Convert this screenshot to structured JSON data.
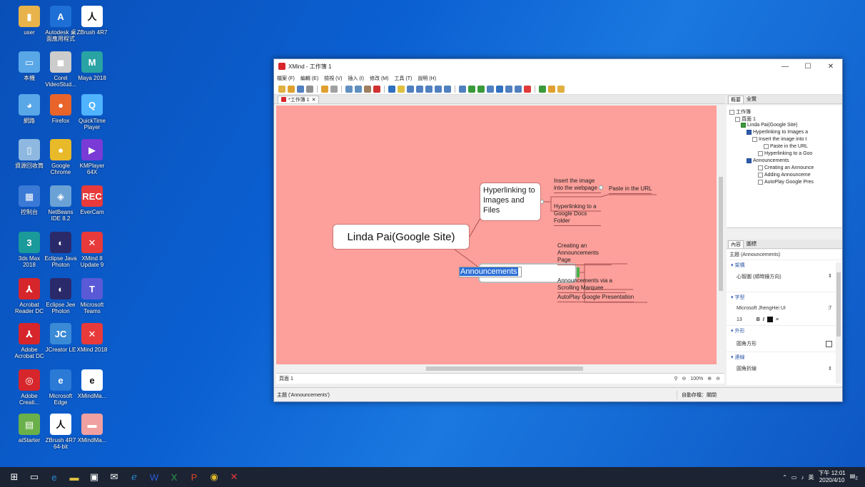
{
  "desktop": {
    "icons": [
      {
        "label": "user",
        "color": "#e8b34a",
        "glyph": "▮"
      },
      {
        "label": "Autodesk 桌面應用程式",
        "color": "#1e6fd6",
        "glyph": "A"
      },
      {
        "label": "ZBrush 4R7",
        "color": "#ffffff",
        "glyph": "人"
      },
      {
        "label": "本機",
        "color": "#5aa7e8",
        "glyph": "▭"
      },
      {
        "label": "Corel VideoStud...",
        "color": "#cccccc",
        "glyph": "◼"
      },
      {
        "label": "Maya 2018",
        "color": "#29a3a3",
        "glyph": "M"
      },
      {
        "label": "網路",
        "color": "#5aa7e8",
        "glyph": "◕"
      },
      {
        "label": "Firefox",
        "color": "#e8642a",
        "glyph": "●"
      },
      {
        "label": "QuickTime Player",
        "color": "#4fb3ff",
        "glyph": "Q"
      },
      {
        "label": "資源回收筒",
        "color": "#8eb8e0",
        "glyph": "▯"
      },
      {
        "label": "Google Chrome",
        "color": "#e8ba2a",
        "glyph": "●"
      },
      {
        "label": "KMPlayer 64X",
        "color": "#7a3ad6",
        "glyph": "▶"
      },
      {
        "label": "控制台",
        "color": "#3a7ad6",
        "glyph": "▦"
      },
      {
        "label": "NetBeans IDE 8.2",
        "color": "#6aa2d6",
        "glyph": "◈"
      },
      {
        "label": "EverCam",
        "color": "#e83a3a",
        "glyph": "REC"
      },
      {
        "label": "3ds Max 2018",
        "color": "#1a9a9a",
        "glyph": "3"
      },
      {
        "label": "Eclipse Java Photon",
        "color": "#2a2a6a",
        "glyph": "◐"
      },
      {
        "label": "XMind 8 Update 9",
        "color": "#e83a3a",
        "glyph": "✕"
      },
      {
        "label": "Acrobat Reader DC",
        "color": "#d6262b",
        "glyph": "⅄"
      },
      {
        "label": "Eclipse Jee Photon",
        "color": "#2a2a6a",
        "glyph": "◐"
      },
      {
        "label": "Microsoft Teams",
        "color": "#5a5ad6",
        "glyph": "T"
      },
      {
        "label": "Adobe Acrobat DC",
        "color": "#d6262b",
        "glyph": "⅄"
      },
      {
        "label": "JCreator LE",
        "color": "#3a8ad6",
        "glyph": "JC"
      },
      {
        "label": "XMind 2018",
        "color": "#e83a3a",
        "glyph": "✕"
      },
      {
        "label": "Adobe Creati...",
        "color": "#d6262b",
        "glyph": "◎"
      },
      {
        "label": "Microsoft Edge",
        "color": "#2a7ad6",
        "glyph": "e"
      },
      {
        "label": "XMindMa...",
        "color": "#ffffff",
        "glyph": "e"
      },
      {
        "label": "aiStarter",
        "color": "#6ab04a",
        "glyph": "▤"
      },
      {
        "label": "ZBrush 4R7 64-bit",
        "color": "#ffffff",
        "glyph": "人"
      },
      {
        "label": "XMindMa...",
        "color": "#f0a0a0",
        "glyph": "▬"
      }
    ]
  },
  "window": {
    "title": "XMind - 工作簿 1",
    "menu": [
      "檔案 (F)",
      "編輯 (E)",
      "檢視 (V)",
      "插入 (I)",
      "修改 (M)",
      "工具 (T)",
      "說明 (H)"
    ],
    "editor_tab": "*工作簿 1",
    "sheet_tab": "頁面 1",
    "zoom": "100%",
    "status_left": "主題 ('Announcements')",
    "status_autosave": "自動存檔：關閉",
    "canvas_color": "#fd9f9a",
    "winbtns": {
      "min": "—",
      "max": "☐",
      "close": "✕"
    }
  },
  "mindmap": {
    "central": "Linda Pai(Google Site)",
    "topic1": "Hyperlinking to Images and Files",
    "topic2_editing": "Announcements",
    "sub_insert": "Insert the image into the webpage",
    "sub_paste": "Paste in the URL",
    "sub_hyperlink_docs": "Hyperlinking to a Google Docs Folder",
    "sub_create_ann": "Creating an Announcements Page",
    "sub_scrolling": "Announcements via a Scrolling Marquee",
    "sub_autoplay": "AutoPlay Google Presentation"
  },
  "outline_panel": {
    "tabs": [
      "概要",
      "全覽"
    ],
    "items": [
      "工作簿",
      "頁面 1",
      "Linda Pai(Google Site)",
      "Hyperlinking to Images a",
      "Insert the image into t",
      "Paste in the URL",
      "Hyperlinking to a Goo",
      "Announcements",
      "Creating an Announce",
      "Adding Announceme",
      "AutoPlay Google Pres"
    ]
  },
  "props_panel": {
    "tabs": [
      "內容",
      "圖標"
    ],
    "subject": "主題 (Announcements)",
    "sec_structure": "▾ 架構",
    "structure_value": "心智圖 (順時鐘方向)",
    "sec_font": "▾ 字型",
    "font_name": "Microsoft JhengHei UI",
    "font_size": "13",
    "sec_shape": "▾ 外形",
    "shape_value": "圓角方形",
    "sec_line": "▾ 連線",
    "line_value": "圓角折線"
  },
  "taskbar": {
    "clock_time": "下午 12:01",
    "clock_date": "2020/4/10",
    "ime": "英",
    "notif_count": "2"
  }
}
